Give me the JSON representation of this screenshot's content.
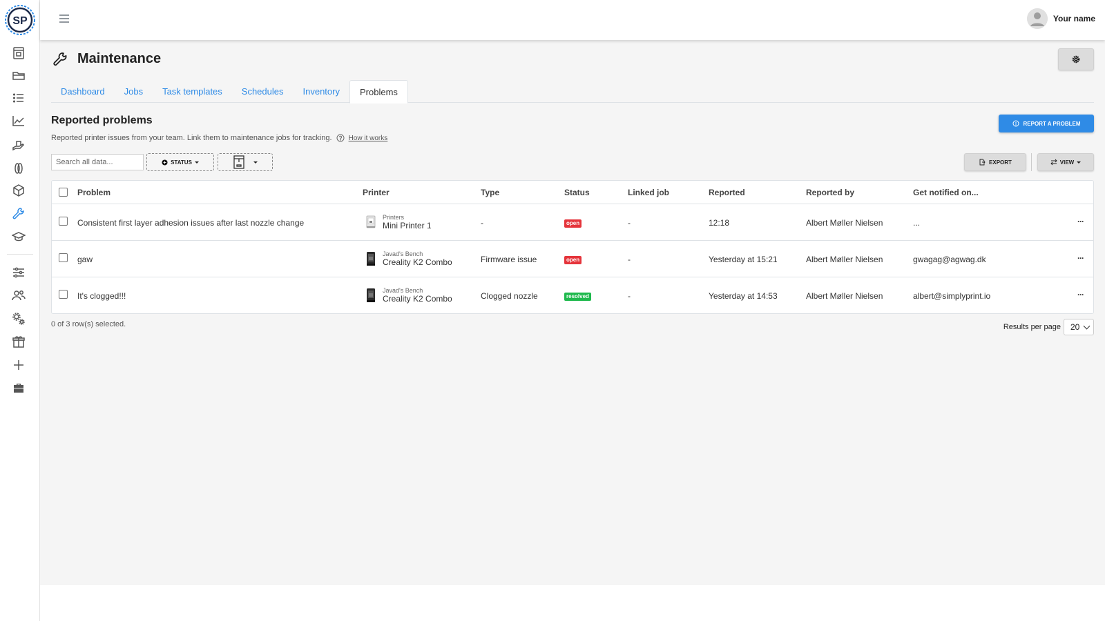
{
  "app": {
    "logo_text": "SP",
    "user_name": "Your name"
  },
  "colors": {
    "accent": "#2f8be6",
    "status_open": "#e5343b",
    "status_resolved": "#1fb94d"
  },
  "sidebar": {
    "items": [
      {
        "icon": "printer-icon"
      },
      {
        "icon": "folder-icon"
      },
      {
        "icon": "list-icon"
      },
      {
        "icon": "statistics-icon"
      },
      {
        "icon": "hand-icon"
      },
      {
        "icon": "filament-spool-icon"
      },
      {
        "icon": "cube-icon"
      },
      {
        "icon": "wrench-icon",
        "active": true
      },
      {
        "icon": "graduation-cap-icon"
      },
      {
        "icon": "sliders-icon"
      },
      {
        "icon": "users-icon"
      },
      {
        "icon": "gears-icon"
      },
      {
        "icon": "gift-icon"
      },
      {
        "icon": "plus-icon"
      },
      {
        "icon": "briefcase-icon"
      }
    ]
  },
  "page": {
    "title": "Maintenance",
    "tabs": [
      {
        "label": "Dashboard"
      },
      {
        "label": "Jobs"
      },
      {
        "label": "Task templates"
      },
      {
        "label": "Schedules"
      },
      {
        "label": "Inventory"
      },
      {
        "label": "Problems",
        "active": true
      }
    ]
  },
  "section": {
    "title": "Reported problems",
    "description": "Reported printer issues from your team. Link them to maintenance jobs for tracking.",
    "how_link": "How it works",
    "report_button": "REPORT A PROBLEM"
  },
  "toolbar": {
    "search_placeholder": "Search all data...",
    "status_filter": "STATUS",
    "export_label": "EXPORT",
    "view_label": "VIEW"
  },
  "table": {
    "columns": [
      "Problem",
      "Printer",
      "Type",
      "Status",
      "Linked job",
      "Reported",
      "Reported by",
      "Get notified on..."
    ],
    "rows": [
      {
        "problem": "Consistent first layer adhesion issues after last nozzle change",
        "printer_group": "Printers",
        "printer_name": "Mini Printer 1",
        "type": "-",
        "status": "open",
        "linked_job": "-",
        "reported": "12:18",
        "reported_by": "Albert Møller Nielsen",
        "notified_on": "..."
      },
      {
        "problem": "gaw",
        "printer_group": "Javad's Bench",
        "printer_name": "Creality K2 Combo",
        "type": "Firmware issue",
        "status": "open",
        "linked_job": "-",
        "reported": "Yesterday at 15:21",
        "reported_by": "Albert Møller Nielsen",
        "notified_on": "gwagag@agwag.dk"
      },
      {
        "problem": "It's clogged!!!",
        "printer_group": "Javad's Bench",
        "printer_name": "Creality K2 Combo",
        "type": "Clogged nozzle",
        "status": "resolved",
        "linked_job": "-",
        "reported": "Yesterday at 14:53",
        "reported_by": "Albert Møller Nielsen",
        "notified_on": "albert@simplyprint.io"
      }
    ],
    "row_action": "···"
  },
  "footer": {
    "selected_text": "0 of 3 row(s) selected.",
    "per_page_label": "Results per page",
    "per_page_value": "20"
  }
}
